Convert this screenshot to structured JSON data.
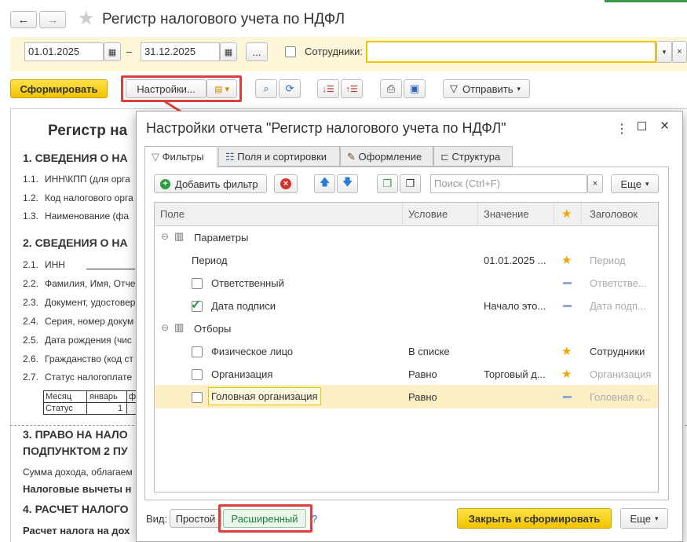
{
  "window": {
    "title": "Регистр налогового учета по НДФЛ"
  },
  "filter": {
    "date_from": "01.01.2025",
    "dash": "–",
    "date_to": "31.12.2025",
    "ellipsis": "...",
    "employees_label": "Сотрудники:"
  },
  "toolbar": {
    "generate": "Сформировать",
    "settings": "Настройки...",
    "send": "Отправить"
  },
  "report": {
    "title": "Регистр на",
    "s1": "1. СВЕДЕНИЯ О НА",
    "s1_items": [
      {
        "n": "1.1.",
        "t": "ИНН\\КПП (для орга"
      },
      {
        "n": "1.2.",
        "t": "Код налогового орга"
      },
      {
        "n": "1.3.",
        "t": "Наименование (фа"
      }
    ],
    "s2": "2. СВЕДЕНИЯ О НА",
    "s2_items": [
      {
        "n": "2.1.",
        "t": "ИНН"
      },
      {
        "n": "2.2.",
        "t": "Фамилия, Имя, Отче"
      },
      {
        "n": "2.3.",
        "t": "Документ, удостовер"
      },
      {
        "n": "2.4.",
        "t": "Серия, номер докум"
      },
      {
        "n": "2.5.",
        "t": "Дата рождения (чис"
      },
      {
        "n": "2.6.",
        "t": "Гражданство (код ст"
      },
      {
        "n": "2.7.",
        "t": "Статус налогоплате"
      }
    ],
    "table": {
      "c1": "Месяц",
      "c2": "январь",
      "c3": "ф",
      "r1": "Статус",
      "r2": "1"
    },
    "s3a": "3. ПРАВО НА НАЛО",
    "s3b": "ПОДПУНКТОМ 2 ПУ",
    "s3_text": "Сумма дохода, облагаем",
    "deductions": "Налоговые вычеты н",
    "s4": "4. РАСЧЕТ НАЛОГО",
    "s4_text": "Расчет налога на дох"
  },
  "dialog": {
    "title": "Настройки отчета \"Регистр налогового учета по НДФЛ\"",
    "tabs": [
      "Фильтры",
      "Поля и сортировки",
      "Оформление",
      "Структура"
    ],
    "add_filter": "Добавить фильтр",
    "search_placeholder": "Поиск (Ctrl+F)",
    "more": "Еще",
    "columns": {
      "field": "Поле",
      "condition": "Условие",
      "value": "Значение",
      "star": "★",
      "header": "Заголовок"
    },
    "rows": [
      {
        "field": "Параметры",
        "condition": "",
        "value": "",
        "header": ""
      },
      {
        "field": "Период",
        "condition": "",
        "value": "01.01.2025 ...",
        "header": "Период"
      },
      {
        "field": "Ответственный",
        "condition": "",
        "value": "",
        "header": "Ответстве..."
      },
      {
        "field": "Дата подписи",
        "condition": "",
        "value": "Начало это...",
        "header": "Дата подп..."
      },
      {
        "field": "Отборы",
        "condition": "",
        "value": "",
        "header": ""
      },
      {
        "field": "Физическое лицо",
        "condition": "В списке",
        "value": "",
        "header": "Сотрудники"
      },
      {
        "field": "Организация",
        "condition": "Равно",
        "value": "Торговый д...",
        "header": "Организация"
      },
      {
        "field": "Головная организация",
        "condition": "Равно",
        "value": "",
        "header": "Головная о..."
      }
    ],
    "view_label": "Вид:",
    "view_simple": "Простой",
    "view_extended": "Расширенный",
    "help": "?",
    "close_generate": "Закрыть и сформировать",
    "more_bottom": "Еще"
  },
  "colors": {
    "accent": "#f1c400",
    "highlight": "#d9413d",
    "green": "#1a7f3c"
  }
}
